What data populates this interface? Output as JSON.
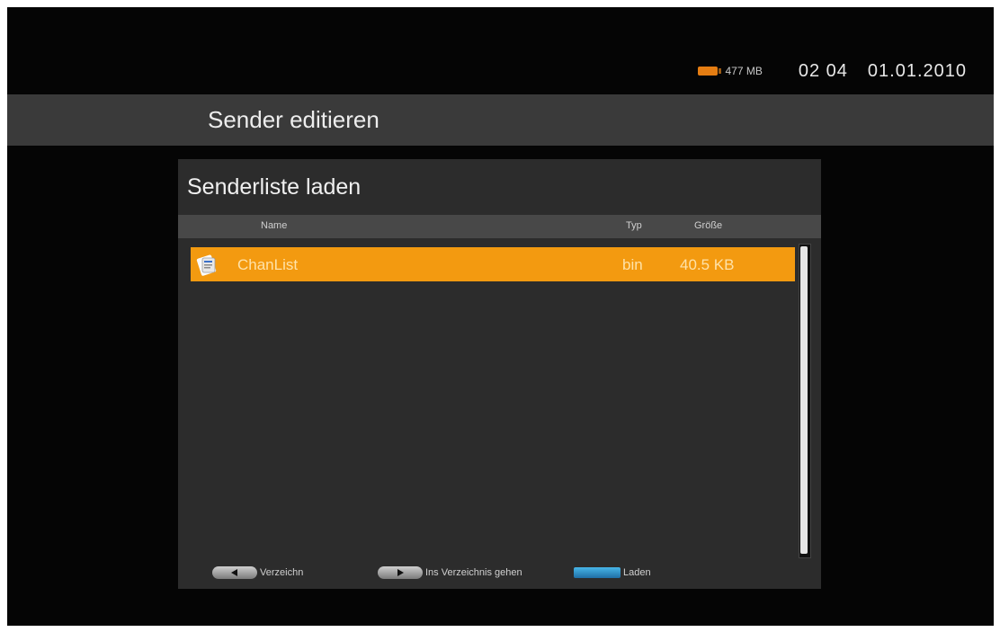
{
  "status": {
    "storage_icon": "storage-drive-icon",
    "storage": "477 MB",
    "time": "02 04",
    "date": "01.01.2010"
  },
  "header": {
    "title": "Sender editieren"
  },
  "panel": {
    "title": "Senderliste laden",
    "columns": {
      "name": "Name",
      "type": "Typ",
      "size": "Größe"
    },
    "files": [
      {
        "name": "ChanList",
        "type": "bin",
        "size": "40.5 KB",
        "icon": "file-icon",
        "selected": true
      }
    ],
    "highlight_color": "#f39a10"
  },
  "footer": {
    "left_key_icon": "left-arrow-key-icon",
    "left_label": "Verzeichn",
    "right_key_icon": "right-arrow-key-icon",
    "right_label": "Ins Verzeichnis gehen",
    "blue_key_icon": "blue-key-icon",
    "blue_label": "Laden",
    "blue_color": "#2a8fcc"
  }
}
